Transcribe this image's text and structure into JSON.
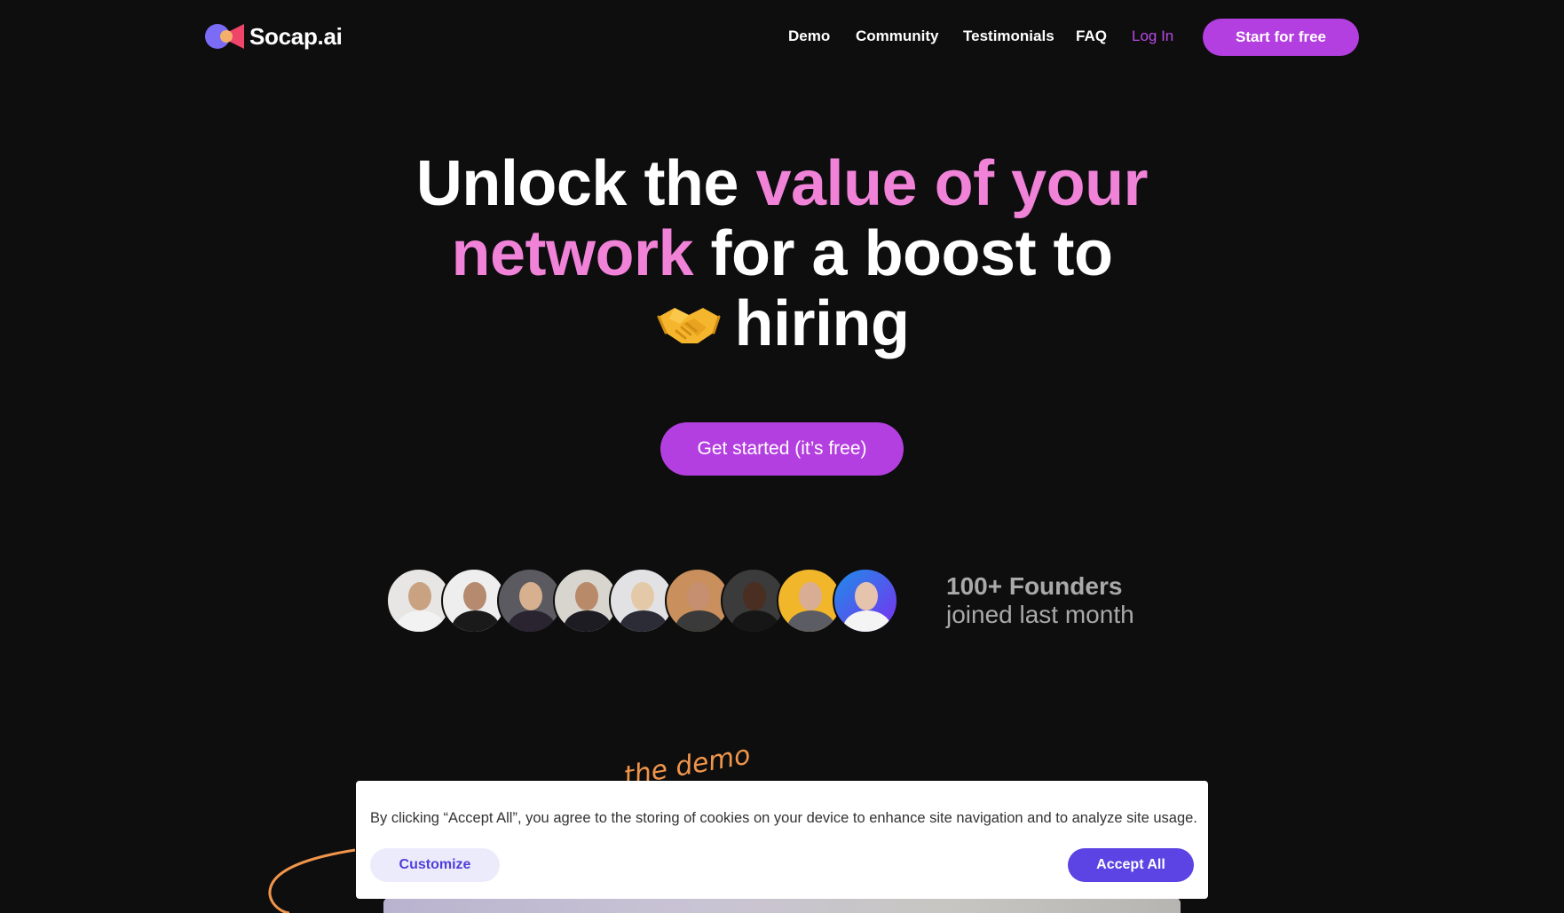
{
  "brand": {
    "name": "Socap.ai",
    "accent": "#b43fe0",
    "pink": "#f082d8"
  },
  "nav": {
    "links": [
      "Demo",
      "Community",
      "Testimonials",
      "FAQ"
    ],
    "login_label": "Log In",
    "start_label": "Start for free"
  },
  "hero": {
    "line1_white": "Unlock the ",
    "line1_pink": "value of your",
    "line2_pink": "network",
    "line2_white": " for a boost to",
    "line3_white": "hiring",
    "line3_icon": "handshake-emoji-icon"
  },
  "cta": {
    "label": "Get started (it’s free)"
  },
  "social_proof": {
    "count": "100+ Founders",
    "subtitle": "joined last month",
    "avatar_count": 9
  },
  "demo_scribble": {
    "text": "the demo"
  },
  "cookie": {
    "text": "By clicking “Accept All”, you agree to the storing of cookies on your device to enhance site navigation and to analyze site usage.",
    "customize_label": "Customize",
    "accept_label": "Accept All",
    "accept_color": "#5b44e3"
  }
}
